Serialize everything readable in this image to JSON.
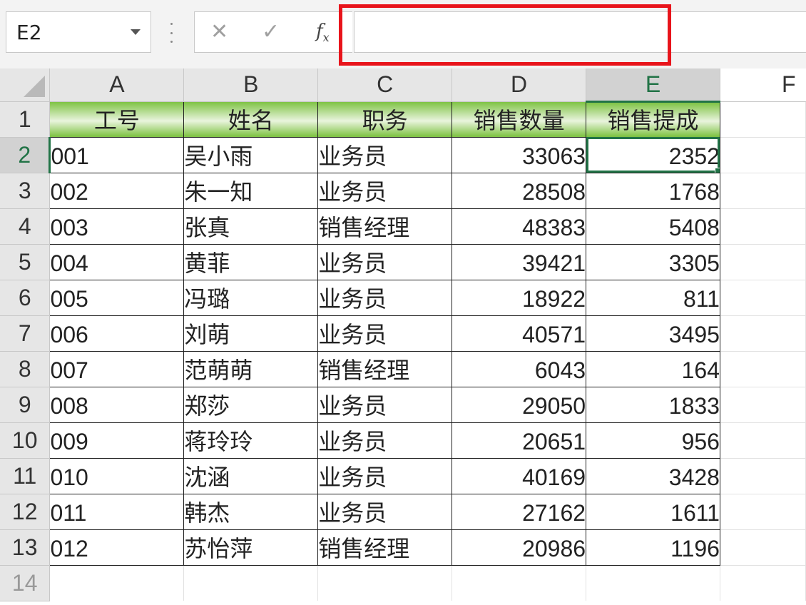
{
  "name_box": {
    "value": "E2"
  },
  "formula_bar": {
    "fx_label": "f",
    "fx_sub": "x",
    "cancel_glyph": "✕",
    "enter_glyph": "✓",
    "value": ""
  },
  "columns": [
    "A",
    "B",
    "C",
    "D",
    "E",
    "F"
  ],
  "active_column": "E",
  "active_row": 2,
  "header_row": [
    "工号",
    "姓名",
    "职务",
    "销售数量",
    "销售提成"
  ],
  "rows": [
    [
      "001",
      "吴小雨",
      "业务员",
      "33063",
      "2352"
    ],
    [
      "002",
      "朱一知",
      "业务员",
      "28508",
      "1768"
    ],
    [
      "003",
      "张真",
      "销售经理",
      "48383",
      "5408"
    ],
    [
      "004",
      "黄菲",
      "业务员",
      "39421",
      "3305"
    ],
    [
      "005",
      "冯璐",
      "业务员",
      "18922",
      "811"
    ],
    [
      "006",
      "刘萌",
      "业务员",
      "40571",
      "3495"
    ],
    [
      "007",
      "范萌萌",
      "销售经理",
      "6043",
      "164"
    ],
    [
      "008",
      "郑莎",
      "业务员",
      "29050",
      "1833"
    ],
    [
      "009",
      "蒋玲玲",
      "业务员",
      "20651",
      "956"
    ],
    [
      "010",
      "沈涵",
      "业务员",
      "40169",
      "3428"
    ],
    [
      "011",
      "韩杰",
      "业务员",
      "27162",
      "1611"
    ],
    [
      "012",
      "苏怡萍",
      "销售经理",
      "20986",
      "1196"
    ]
  ],
  "row_numbers": [
    "1",
    "2",
    "3",
    "4",
    "5",
    "6",
    "7",
    "8",
    "9",
    "10",
    "11",
    "12",
    "13",
    "14"
  ],
  "colors": {
    "accent": "#217346",
    "highlight": "#e8141b",
    "header_green": "#7dc242"
  }
}
